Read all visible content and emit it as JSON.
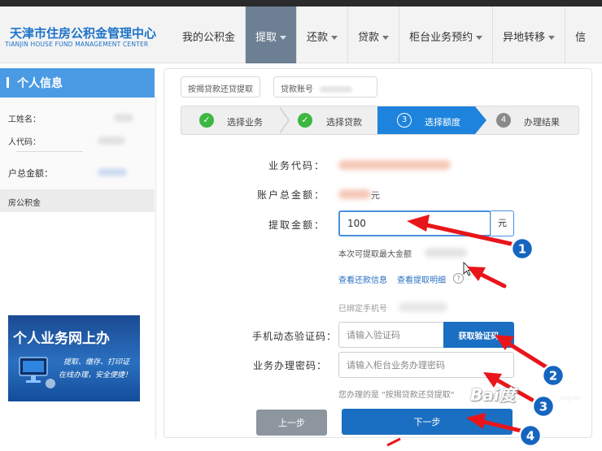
{
  "header": {
    "logo_cn": "天津市住房公积金管理中心",
    "logo_en": "TIANJIN HOUSE FUND MANAGEMENT CENTER",
    "nav": [
      {
        "label": "我的公积金",
        "dropdown": false,
        "active": false
      },
      {
        "label": "提取",
        "dropdown": true,
        "active": true
      },
      {
        "label": "还款",
        "dropdown": true,
        "active": false
      },
      {
        "label": "贷款",
        "dropdown": true,
        "active": false
      },
      {
        "label": "柜台业务预约",
        "dropdown": true,
        "active": false
      },
      {
        "label": "异地转移",
        "dropdown": true,
        "active": false
      },
      {
        "label": "信",
        "dropdown": false,
        "active": false
      }
    ]
  },
  "sidebar": {
    "title": "个人信息",
    "rows": [
      "工姓名：",
      "人代码：",
      "户总金额：",
      "房公积金"
    ],
    "banner": {
      "title": "个人业务网上办",
      "sub1": "提取、缴存、打印证",
      "sub2": "在线办理，安全便捷！"
    }
  },
  "tabs": {
    "chip1": "按揭贷款还贷提取",
    "chip2": "贷款账号"
  },
  "steps": [
    {
      "label": "选择业务",
      "status": "done"
    },
    {
      "label": "选择贷款",
      "status": "done"
    },
    {
      "label": "选择额度",
      "status": "active",
      "number": "3"
    },
    {
      "label": "办理结果",
      "status": "pending",
      "number": "4"
    }
  ],
  "form": {
    "business_code_label": "业务代码：",
    "account_total_label": "账户总金额：",
    "account_total_unit": "元",
    "amount_label": "提取金额：",
    "amount_value": "100",
    "amount_unit": "元",
    "max_hint": "本次可提取最大金额",
    "link_repay": "查看还款信息",
    "link_detail": "查看提取明细",
    "help_mark": "?",
    "phone_bound": "已绑定手机号",
    "sms_label": "手机动态验证码：",
    "sms_placeholder": "请输入验证码",
    "get_code_button": "获取验证码",
    "pwd_label": "业务办理密码：",
    "pwd_placeholder": "请输入柜台业务办理密码",
    "current_business": "您办理的是 \"按揭贷款还贷提取\"",
    "prev_button": "上一步",
    "next_button": "下一步"
  },
  "annotations": {
    "markers": [
      "1",
      "2",
      "3",
      "4"
    ],
    "arrow_color": "#e8151b",
    "badge_color": "#1565c0"
  },
  "watermark": {
    "brand": "Bai度",
    "sub": "jingyan"
  },
  "colors": {
    "brand": "#1d73c9",
    "nav_active": "#6d7f93",
    "primary_button": "#1a6fc2",
    "step_active": "#1e83dc",
    "step_done": "#3db742"
  }
}
